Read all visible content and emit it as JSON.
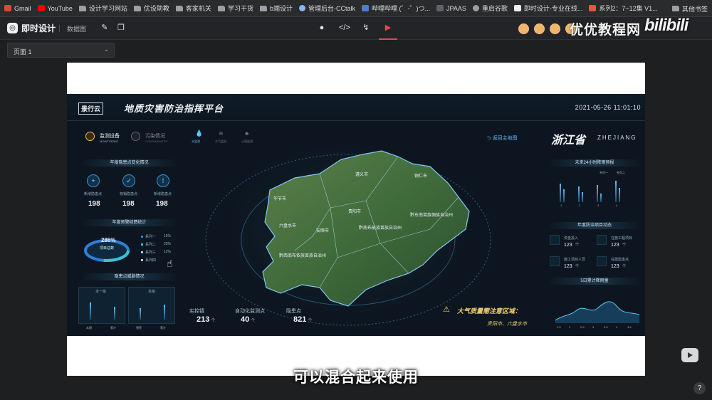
{
  "browser": {
    "bookmarks": [
      {
        "label": "Gmail",
        "icon": "gmail-icon"
      },
      {
        "label": "YouTube",
        "icon": "youtube-icon"
      },
      {
        "label": "设计学习网站",
        "icon": "folder-icon"
      },
      {
        "label": "优设助教",
        "icon": "folder-icon"
      },
      {
        "label": "客家机关",
        "icon": "folder-icon"
      },
      {
        "label": "学习干货",
        "icon": "folder-icon"
      },
      {
        "label": "b端设计",
        "icon": "folder-icon"
      },
      {
        "label": "管理后台-CCtalk",
        "icon": "circle-icon"
      },
      {
        "label": "哔哩哔哩 (゜-゜)つ...",
        "icon": "bilibili-icon"
      },
      {
        "label": "JPAAS",
        "icon": "doc-icon"
      },
      {
        "label": "重启谷歌",
        "icon": "globe-icon"
      },
      {
        "label": "即时设计-专业在线...",
        "icon": "jsdesign-icon"
      },
      {
        "label": "系列2：7~12集 V1...",
        "icon": "doc-icon"
      }
    ],
    "other_bookmarks": "其他书签"
  },
  "app": {
    "logo_glyph": "◎",
    "name": "即时设计",
    "data_map_label": "数据图",
    "page_select_value": "页面 1",
    "watermark": "优优教程网",
    "bilibili": "bilibili"
  },
  "dashboard": {
    "logo": "景行云",
    "title": "地质灾害防治指挥平台",
    "time": "2021-05-26 11:01:10",
    "tabs_left": [
      "监测设备",
      "污染情况"
    ],
    "tabs_left_en": [
      "MONITORING",
      "CONTAMINATED"
    ],
    "icon_tabs": [
      "水监测",
      "大气监测",
      "土壤监测"
    ],
    "annual_title": "年度隐患点变化情况",
    "annual_items": [
      {
        "label": "新增隐患点",
        "value": "198",
        "glyph": "+"
      },
      {
        "label": "核销隐患点",
        "value": "198",
        "glyph": "✓"
      },
      {
        "label": "新增隐患点",
        "value": "198",
        "glyph": "!"
      }
    ],
    "budget_title": "年度预警经费统计",
    "donut_value": "286",
    "donut_unit": "%",
    "donut_label": "项目总数",
    "legend": [
      {
        "name": "系列一",
        "pct": "15%",
        "color": "#2f7fd8"
      },
      {
        "name": "系列二",
        "pct": "25%",
        "color": "#39c2d7"
      },
      {
        "name": "系列三",
        "pct": "12%",
        "color": "#8fd3f4"
      },
      {
        "name": "系列四",
        "pct": "",
        "color": "#c5c9cf"
      }
    ],
    "threat_title": "隐患点威胁情况",
    "threat_subtabs": [
      "本一级",
      "本级"
    ],
    "threat_labels": [
      "本期",
      "累计",
      "预警",
      "累计"
    ],
    "back_button": "返回主地图",
    "province": "浙江省",
    "province_en": "ZHEJIANG",
    "rain_title": "未来24小时降雨预报",
    "rain_legend": [
      "系列一",
      "系列二"
    ],
    "rain_x": [
      "1",
      "2",
      "3",
      "4"
    ],
    "projects_title": "年度防治项目动态",
    "projects": [
      {
        "label": "资金投入",
        "value": "123",
        "unit": "个"
      },
      {
        "label": "在施工程项目",
        "value": "123",
        "unit": "个"
      },
      {
        "label": "施工项目人员",
        "value": "123",
        "unit": "个"
      },
      {
        "label": "在建隐患点",
        "value": "123",
        "unit": "个"
      }
    ],
    "rainfall5_title": "5日累计降雨量",
    "rainfall5_x": [
      "1.5",
      "2",
      "2.5",
      "3",
      "3.5",
      "4",
      "4.5"
    ],
    "stats": [
      {
        "label": "实控镇",
        "value": "213",
        "unit": "个"
      },
      {
        "label": "自动化监测点",
        "value": "40",
        "unit": "个"
      },
      {
        "label": "隐患点",
        "value": "821",
        "unit": "个"
      }
    ],
    "warning": "大气质量需注意区域：",
    "warning_regions": "贵阳市、六盘水市",
    "map_labels": [
      "毕节市",
      "贵阳市",
      "安顺市",
      "六盘水市",
      "黔南布依族苗族自治州",
      "黔东南苗族侗族自治州",
      "黔西南布依族苗族自治州",
      "铜仁市",
      "遵义市"
    ]
  },
  "subtitle": "可以混合起来使用",
  "help_glyph": "?",
  "colors": {
    "accent_red": "#e5484d",
    "dash_bg": "#0d1620",
    "map_green": "#3f6b3a",
    "warn_yellow": "#f0d070"
  }
}
